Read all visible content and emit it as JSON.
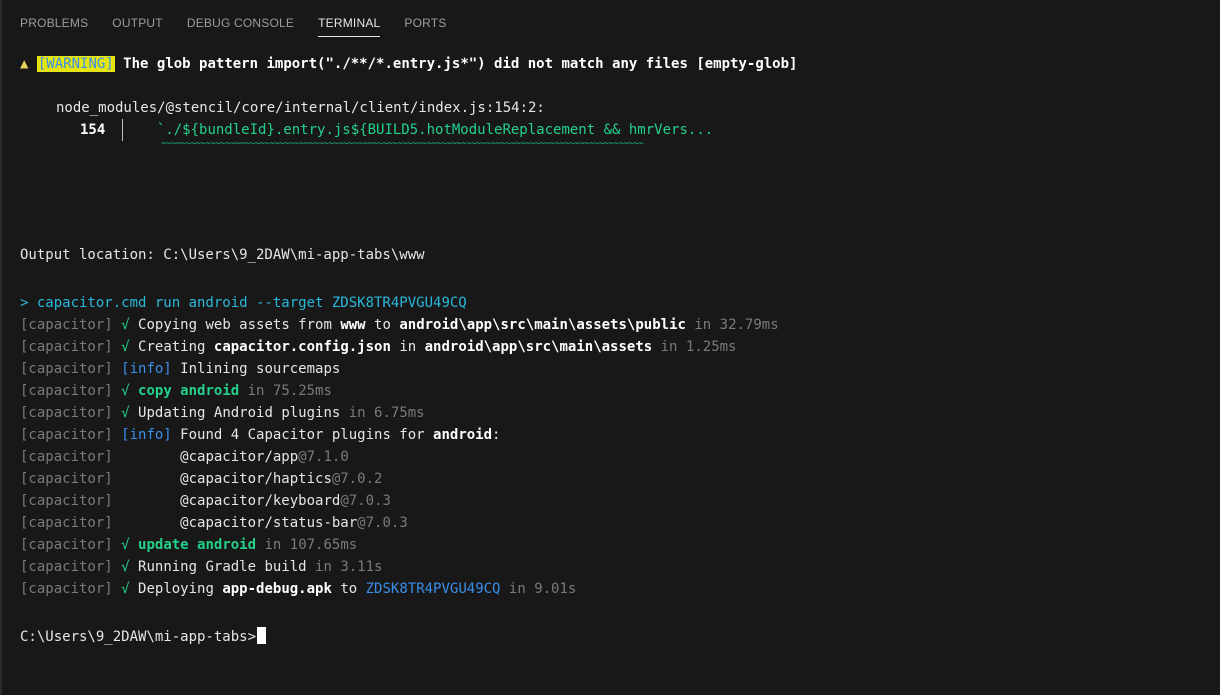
{
  "tabs": [
    {
      "label": "PROBLEMS"
    },
    {
      "label": "OUTPUT"
    },
    {
      "label": "DEBUG CONSOLE"
    },
    {
      "label": "TERMINAL",
      "active": true
    },
    {
      "label": "PORTS"
    }
  ],
  "warning": {
    "icon": "▲",
    "badge": "[WARNING]",
    "message": "The glob pattern import(\"./**/*.entry.js*\") did not match any files [empty-glob]",
    "location": "node_modules/@stencil/core/internal/client/index.js:154:2:",
    "line_number": "154",
    "code": "`./${bundleId}.entry.js${BUILD5.hotModuleReplacement && hmrVers...",
    "squiggle": "~~~~~~~~~~~~~~~~~~~~~~~~~~~~~~~~~~~~~~~~~~~~~~~~~~~~~~~~~~~~~~~~~~~~~~~~~~~~~~~~~~~~~~~~~~~~~~~~~~"
  },
  "output_location": "Output location: C:\\Users\\9_2DAW\\mi-app-tabs\\www",
  "command": {
    "prompt": "> ",
    "text": "capacitor.cmd run android --target ZDSK8TR4PVGU49CQ"
  },
  "cap_prefix": "[capacitor]",
  "check": "√",
  "log": {
    "l1": {
      "a": "Copying web assets from ",
      "b": "www",
      "c": " to ",
      "d": "android\\app\\src\\main\\assets\\public",
      "e": " in 32.79ms"
    },
    "l2": {
      "a": "Creating ",
      "b": "capacitor.config.json",
      "c": " in ",
      "d": "android\\app\\src\\main\\assets",
      "e": " in 1.25ms"
    },
    "l3": {
      "tag": "[info]",
      "a": " Inlining sourcemaps"
    },
    "l4": {
      "a": "copy android",
      "e": " in 75.25ms"
    },
    "l5": {
      "a": "Updating Android plugins",
      "e": " in 6.75ms"
    },
    "l6": {
      "tag": "[info]",
      "a": " Found 4 Capacitor plugins for ",
      "b": "android",
      "c": ":"
    },
    "p1": {
      "name": "@capacitor/app",
      "ver": "@7.1.0"
    },
    "p2": {
      "name": "@capacitor/haptics",
      "ver": "@7.0.2"
    },
    "p3": {
      "name": "@capacitor/keyboard",
      "ver": "@7.0.3"
    },
    "p4": {
      "name": "@capacitor/status-bar",
      "ver": "@7.0.3"
    },
    "l7": {
      "a": "update android",
      "e": " in 107.65ms"
    },
    "l8": {
      "a": "Running Gradle build",
      "e": " in 3.11s"
    },
    "l9": {
      "a": "Deploying ",
      "b": "app-debug.apk",
      "c": " to ",
      "d": "ZDSK8TR4PVGU49CQ",
      "e": " in 9.01s"
    }
  },
  "prompt": "C:\\Users\\9_2DAW\\mi-app-tabs>",
  "colors": {
    "background": "#181818",
    "green": "#23d18b",
    "blue": "#3b8eea",
    "warning_bg": "#e5e510"
  }
}
